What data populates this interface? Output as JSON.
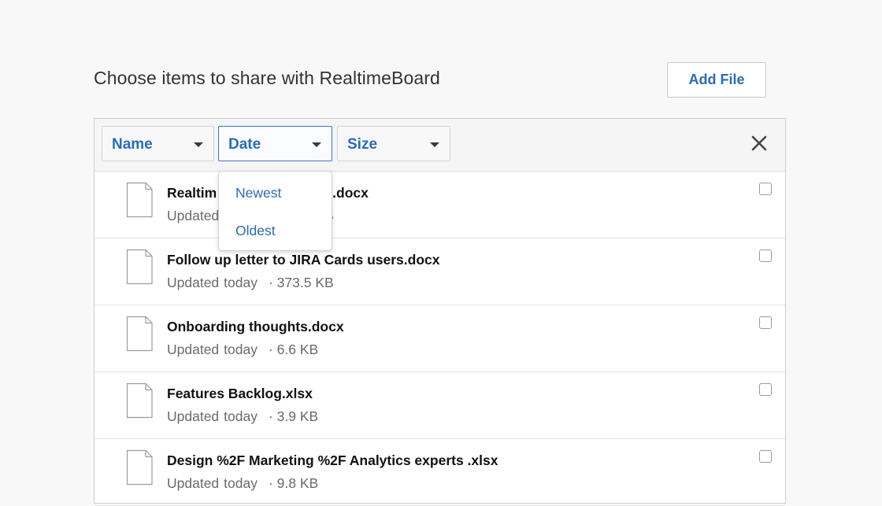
{
  "dialog": {
    "title": "Choose items to share with RealtimeBoard",
    "add_file_label": "Add File"
  },
  "filters": {
    "name_label": "Name",
    "date_label": "Date",
    "size_label": "Size",
    "active": "Date"
  },
  "date_menu": {
    "options": [
      "Newest",
      "Oldest"
    ]
  },
  "files": [
    {
      "name": "Realtim",
      "name_tail": "s Video.docx",
      "updated": "Updated",
      "date": "",
      "size": "B"
    },
    {
      "name": "Follow up letter to JIRA Cards users.docx",
      "updated": "Updated",
      "date": "today",
      "size": "· 373.5 KB"
    },
    {
      "name": "Onboarding thoughts.docx",
      "updated": "Updated",
      "date": "today",
      "size": "· 6.6 KB"
    },
    {
      "name": "Features Backlog.xlsx",
      "updated": "Updated",
      "date": "today",
      "size": "· 3.9 KB"
    },
    {
      "name": "Design %2F Marketing %2F Analytics experts .xlsx",
      "updated": "Updated",
      "date": "today",
      "size": "· 9.8 KB"
    }
  ],
  "icons": {
    "file": "document-icon",
    "close": "close-icon",
    "caret": "chevron-down-icon"
  },
  "colors": {
    "accent": "#2a6cb8",
    "background": "#f8f8f8"
  }
}
